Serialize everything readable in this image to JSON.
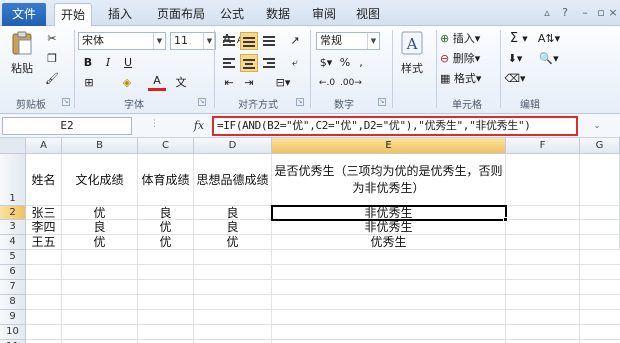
{
  "ribbon_tabs": {
    "file": "文件",
    "items": [
      "开始",
      "插入",
      "页面布局",
      "公式",
      "数据",
      "审阅",
      "视图"
    ]
  },
  "clipboard": {
    "paste": "粘贴",
    "group": "剪贴板"
  },
  "font": {
    "name": "宋体",
    "size": "11",
    "bold": "B",
    "italic": "I",
    "underline": "U",
    "font_color": "A",
    "group": "字体"
  },
  "alignment": {
    "group": "对齐方式"
  },
  "number": {
    "format": "常规",
    "group": "数字"
  },
  "styles": {
    "label": "样式"
  },
  "cells": {
    "insert": "插入",
    "delete": "删除",
    "format": "格式",
    "group": "单元格"
  },
  "editing": {
    "sum": "Σ",
    "group": "编辑"
  },
  "formula_bar": {
    "name_box": "E2",
    "fx": "fx",
    "formula": "=IF(AND(B2=\"优\",C2=\"优\",D2=\"优\"),\"优秀生\",\"非优秀生\")"
  },
  "columns": [
    "A",
    "B",
    "C",
    "D",
    "E",
    "F",
    "G"
  ],
  "rows": [
    "1",
    "2",
    "3",
    "4",
    "5",
    "6",
    "7",
    "8",
    "9",
    "10",
    "11"
  ],
  "table": {
    "headers": [
      "姓名",
      "文化成绩",
      "体育成绩",
      "思想品德成绩",
      "是否优秀生（三项均为优的是优秀生，否则为非优秀生）"
    ],
    "data": [
      [
        "张三",
        "优",
        "良",
        "良",
        "非优秀生"
      ],
      [
        "李四",
        "良",
        "优",
        "良",
        "非优秀生"
      ],
      [
        "王五",
        "优",
        "优",
        "优",
        "优秀生"
      ]
    ]
  },
  "colors": {
    "accent": "#1f5fb3",
    "formula_highlight": "#e02b2b",
    "active_header": "#f1c15f"
  }
}
